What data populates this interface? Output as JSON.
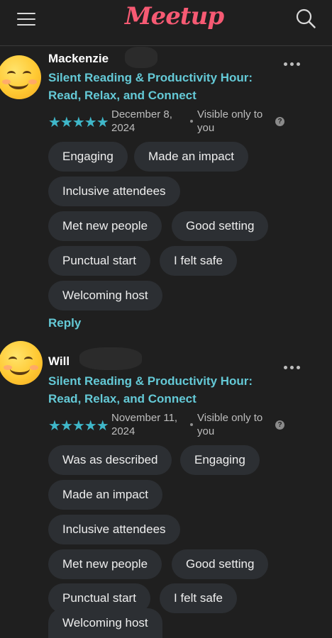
{
  "header": {
    "logo_text": "Meetup"
  },
  "reviews": [
    {
      "author": "Mackenzie",
      "event_title": "Silent Reading & Productivity Hour: Read, Relax, and Connect",
      "rating": 5,
      "stars": "★★★★★",
      "date": "December 8, 2024",
      "visibility": "Visible only to you",
      "help": "?",
      "tags": [
        "Engaging",
        "Made an impact",
        "Inclusive attendees",
        "Met new people",
        "Good setting",
        "Punctual start",
        "I felt safe",
        "Welcoming host"
      ],
      "reply_label": "Reply"
    },
    {
      "author": "Will",
      "event_title": "Silent Reading & Productivity Hour: Read, Relax, and Connect",
      "rating": 5,
      "stars": "★★★★★",
      "date": "November 11, 2024",
      "visibility": "Visible only to you",
      "help": "?",
      "tags": [
        "Was as described",
        "Engaging",
        "Made an impact",
        "Inclusive attendees",
        "Met new people",
        "Good setting",
        "Punctual start",
        "I felt safe",
        "Welcoming host"
      ]
    }
  ],
  "colors": {
    "accent": "#64c9d6",
    "stars": "#3fb7c9",
    "logo": "#f65a73",
    "background": "#1f1f1f",
    "tag_bg": "#2c2f33"
  }
}
